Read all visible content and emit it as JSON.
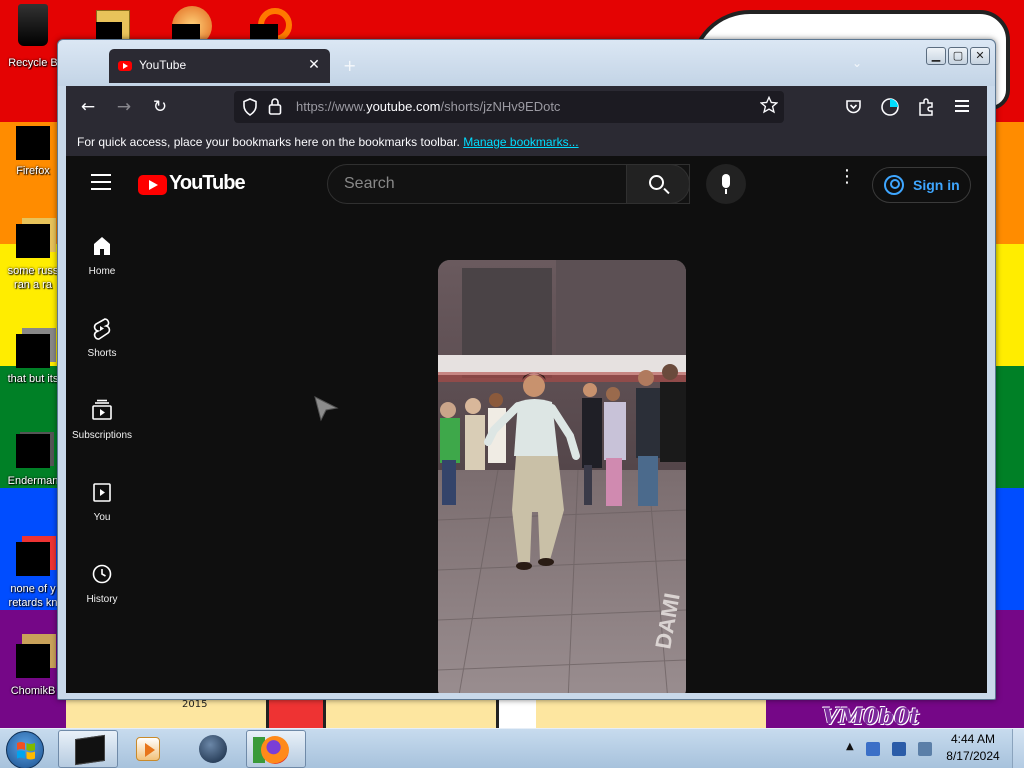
{
  "desktop": {
    "wallpaper_stripes": [
      "#e40303",
      "#ff8c00",
      "#ffed00",
      "#008026",
      "#004dff",
      "#750787"
    ],
    "wall_year": "2015",
    "wall_sign": "VM0b0t",
    "icons": [
      {
        "label": "Recycle B",
        "name": "recycle-bin"
      },
      {
        "label": "Firefox",
        "name": "firefox"
      },
      {
        "label": "some russ",
        "label2": "ran a ra",
        "name": "some-russ"
      },
      {
        "label": "that but its",
        "name": "that-but-its"
      },
      {
        "label": "Enderman",
        "name": "enderman"
      },
      {
        "label": "none of y",
        "label2": "retards kn",
        "name": "none-of-y"
      },
      {
        "label": "ChomikB",
        "name": "chomikb"
      }
    ]
  },
  "browser": {
    "tab_title": "YouTube",
    "tab_close": "✕",
    "new_tab": "+",
    "list_all_tabs": "⌄",
    "window_buttons": {
      "minimize": "▁",
      "maximize": "▢",
      "close": "✕"
    },
    "nav": {
      "back": "←",
      "forward": "→",
      "reload": "↻"
    },
    "url_prefix": "https://www.",
    "url_domain": "youtube.com",
    "url_path": "/shorts/jzNHv9EDotc",
    "bookmarks_text": "For quick access, place your bookmarks here on the bookmarks toolbar.",
    "bookmarks_link": "Manage bookmarks..."
  },
  "youtube": {
    "logo_text": "YouTube",
    "search_placeholder": "Search",
    "signin_label": "Sign in",
    "more": "⋮",
    "nav": [
      {
        "label": "Home",
        "icon": "home-icon"
      },
      {
        "label": "Shorts",
        "icon": "shorts-icon"
      },
      {
        "label": "Subscriptions",
        "icon": "subscriptions-icon"
      },
      {
        "label": "You",
        "icon": "you-icon"
      },
      {
        "label": "History",
        "icon": "history-icon"
      }
    ]
  },
  "taskbar": {
    "clock_time": "4:44 AM",
    "clock_date": "8/17/2024",
    "tray_expand": "▲"
  }
}
